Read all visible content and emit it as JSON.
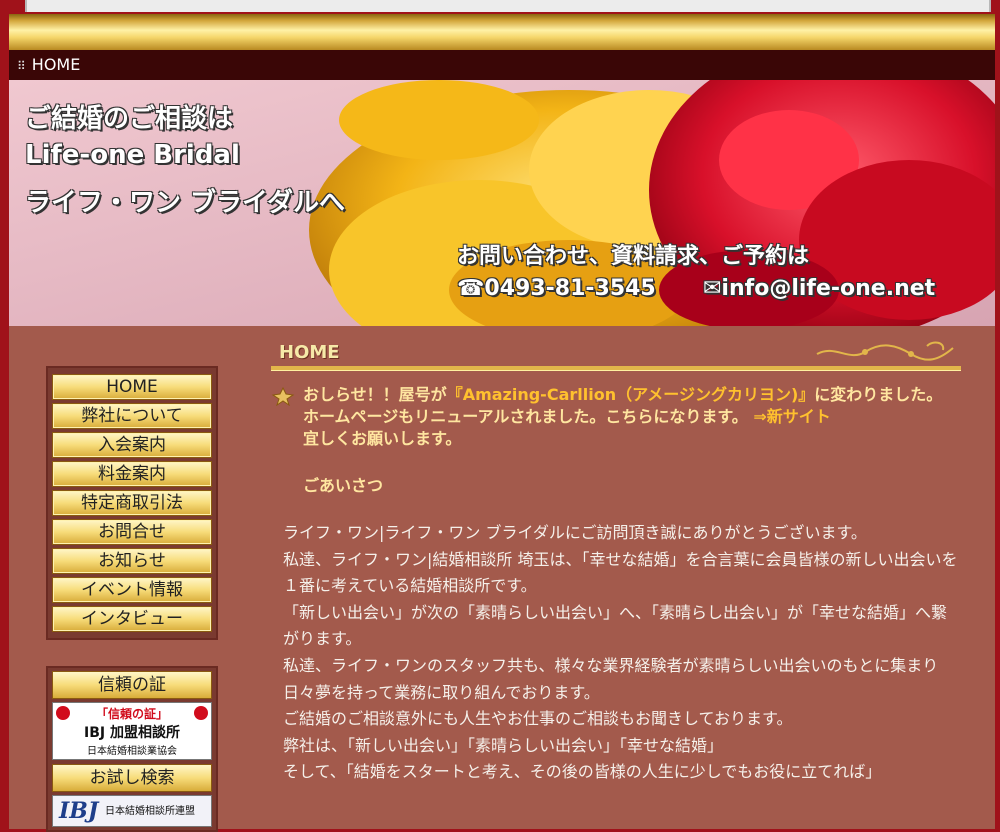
{
  "breadcrumb": {
    "label": "HOME"
  },
  "banner": {
    "line1": "ご結婚のご相談は",
    "line2": "Life-one Bridal",
    "line3": "ライフ・ワン ブライダルへ",
    "contact_line": "お問い合わせ、資料請求、ご予約は",
    "phone": "☎0493-81-3545",
    "email": "✉info@life-one.net"
  },
  "menu": {
    "items": [
      {
        "label": "HOME"
      },
      {
        "label": "弊社について"
      },
      {
        "label": "入会案内"
      },
      {
        "label": "料金案内"
      },
      {
        "label": "特定商取引法"
      },
      {
        "label": "お問合せ"
      },
      {
        "label": "お知らせ"
      },
      {
        "label": "イベント情報"
      },
      {
        "label": "インタビュー"
      }
    ]
  },
  "trust": {
    "heading": "信頼の証",
    "badge": {
      "line1": "「信頼の証」",
      "line2": "IBJ 加盟相談所",
      "line3": "日本結婚相談業協会"
    },
    "search_heading": "お試し検索",
    "search_badge": {
      "logo": "IBJ",
      "text": "日本結婚相談所連盟"
    }
  },
  "main": {
    "heading": "HOME",
    "notice": {
      "prefix": "おしらせ！！屋号が",
      "name": "『Amazing-Carllion（アメージングカリヨン)』",
      "suffix": "に変わりました。",
      "line2": "ホームページもリニューアルされました。こちらになります。",
      "link": "⇒新サイト",
      "line3": "宜しくお願いします。"
    },
    "greeting_heading": "ごあいさつ",
    "paragraphs": [
      "ライフ・ワン|ライフ・ワン ブライダルにご訪問頂き誠にありがとうございます。",
      "私達、ライフ・ワン|結婚相談所 埼玉は、「幸せな結婚」を合言葉に会員皆様の新しい出会いを１番に考えている結婚相談所です。",
      "「新しい出会い」が次の「素晴らしい出会い」へ、「素晴らし出会い」が「幸せな結婚」へ繋がります。",
      "私達、ライフ・ワンのスタッフ共も、様々な業界経験者が素晴らしい出会いのもとに集まり日々夢を持って業務に取り組んでおります。",
      "ご結婚のご相談意外にも人生やお仕事のご相談もお聞きしております。",
      "弊社は、「新しい出会い」「素晴らしい出会い」「幸せな結婚」",
      "そして、「結婚をスタートと考え、その後の皆様の人生に少しでもお役に立てれば」"
    ]
  }
}
